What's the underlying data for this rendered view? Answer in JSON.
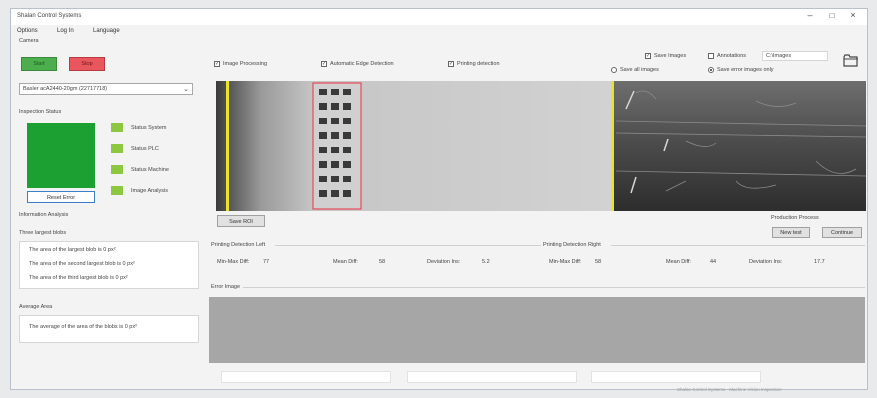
{
  "window": {
    "title": "Shalan Control Systems",
    "minimize": "–",
    "maximize": "□",
    "close": "×"
  },
  "menu": [
    "Options",
    "Log In",
    "Language"
  ],
  "camera": {
    "group_label": "Camera",
    "start_label": "Start",
    "stop_label": "Stop"
  },
  "camera_select": {
    "value": "Basler acA2440-20gm (22717718)"
  },
  "inspection": {
    "group_label": "Inspection Status",
    "statuses": [
      "Status System",
      "Status PLC",
      "Status Machine",
      "Image Analysis"
    ],
    "reset_label": "Reset Error",
    "colors": {
      "ok": "#1ca032",
      "led": "#8dc63f"
    }
  },
  "analysis": {
    "group_label": "Information Analysis",
    "three_largest_label": "Three largest blobs",
    "items": [
      "The area of the largest blob is 0 px²",
      "The area of the second largest blob is 0 px²",
      "The area of the third largest blob is 0 px²"
    ],
    "average_label": "Average Area",
    "average_text": "The average of the area of the blobs is 0 px²"
  },
  "options": {
    "image_processing": "Image Processing",
    "edge_detection": "Automatic Edge Detection",
    "printing_detection": "Printing detection",
    "save_images": "Save Images",
    "annotations": "Annotations",
    "save_path": "C:\\Images",
    "save_all": "Save all images",
    "save_error": "Save error images only",
    "folder_icon": "folder-icon"
  },
  "buttons": {
    "save_roi": "Save ROI",
    "production_process": "Production Process",
    "new_test": "New test",
    "continue": "Continue"
  },
  "printing_left": {
    "group_label": "Printing Detection Left",
    "min_max_label": "Min-Max Diff:",
    "min_max_value": "77",
    "mean_label": "Mean Diff:",
    "mean_value": "58",
    "dev_label": "Deviation Ins:",
    "dev_value": "5.2"
  },
  "printing_right": {
    "group_label": "Printing Detection Right",
    "min_max_label": "Min-Max Diff:",
    "min_max_value": "58",
    "mean_label": "Mean Diff:",
    "mean_value": "44",
    "dev_label": "Deviation Ins:",
    "dev_value": "17.7"
  },
  "error_image_label": "Error Image",
  "footer_text": "Shalan Control Systems - Machine Vision Inspection"
}
